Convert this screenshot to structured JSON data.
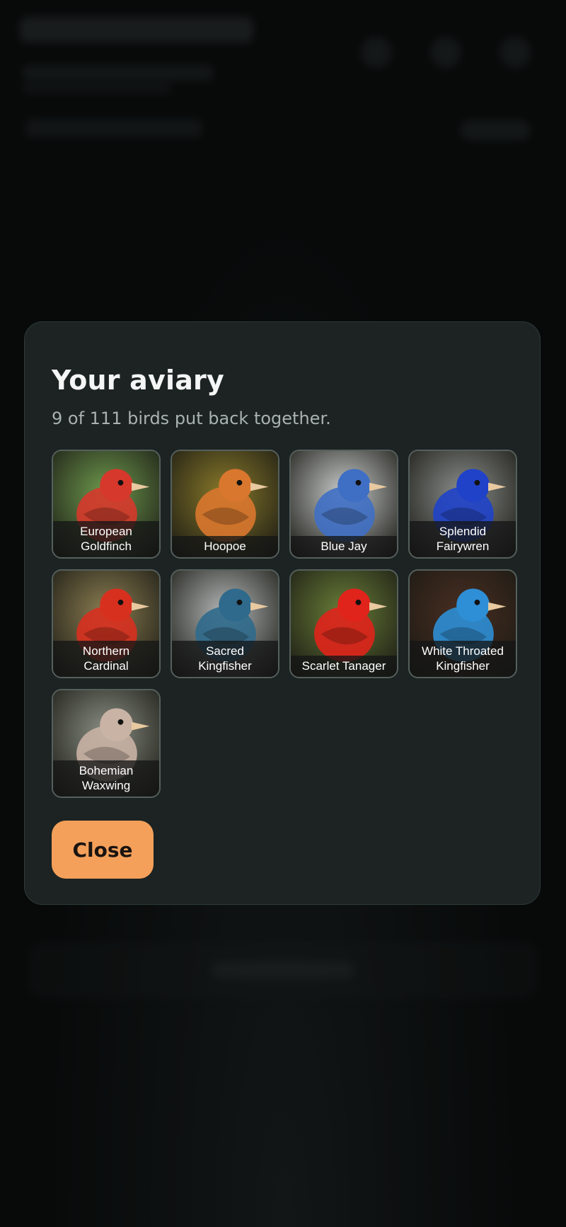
{
  "modal": {
    "title": "Your aviary",
    "subtitle": "9 of 111 birds put back together.",
    "close_label": "Close"
  },
  "birds": [
    {
      "label": "European\nGoldfinch",
      "icon": "goldfinch-photo",
      "bg": "#6f9a4e",
      "accent": "#d6382b"
    },
    {
      "label": "Hoopoe",
      "icon": "hoopoe-photo",
      "bg": "#8a7a2a",
      "accent": "#d9772e"
    },
    {
      "label": "Blue Jay",
      "icon": "blue-jay-photo",
      "bg": "#c9cccc",
      "accent": "#3f6fc4"
    },
    {
      "label": "Splendid\nFairywren",
      "icon": "fairywren-photo",
      "bg": "#8b8e8c",
      "accent": "#1f42c9"
    },
    {
      "label": "Northern\nCardinal",
      "icon": "cardinal-photo",
      "bg": "#8c7e52",
      "accent": "#d8301f"
    },
    {
      "label": "Sacred\nKingfisher",
      "icon": "sacred-kingfisher-photo",
      "bg": "#b4b8b8",
      "accent": "#2f6a8c"
    },
    {
      "label": "Scarlet Tanager",
      "icon": "scarlet-tanager-photo",
      "bg": "#6a7f38",
      "accent": "#e0231b"
    },
    {
      "label": "White Throated\nKingfisher",
      "icon": "white-throated-kingfisher-photo",
      "bg": "#4a2e22",
      "accent": "#2e8fd6"
    },
    {
      "label": "Bohemian\nWaxwing",
      "icon": "waxwing-photo",
      "bg": "#8a8f84",
      "accent": "#c9b3a4"
    }
  ]
}
